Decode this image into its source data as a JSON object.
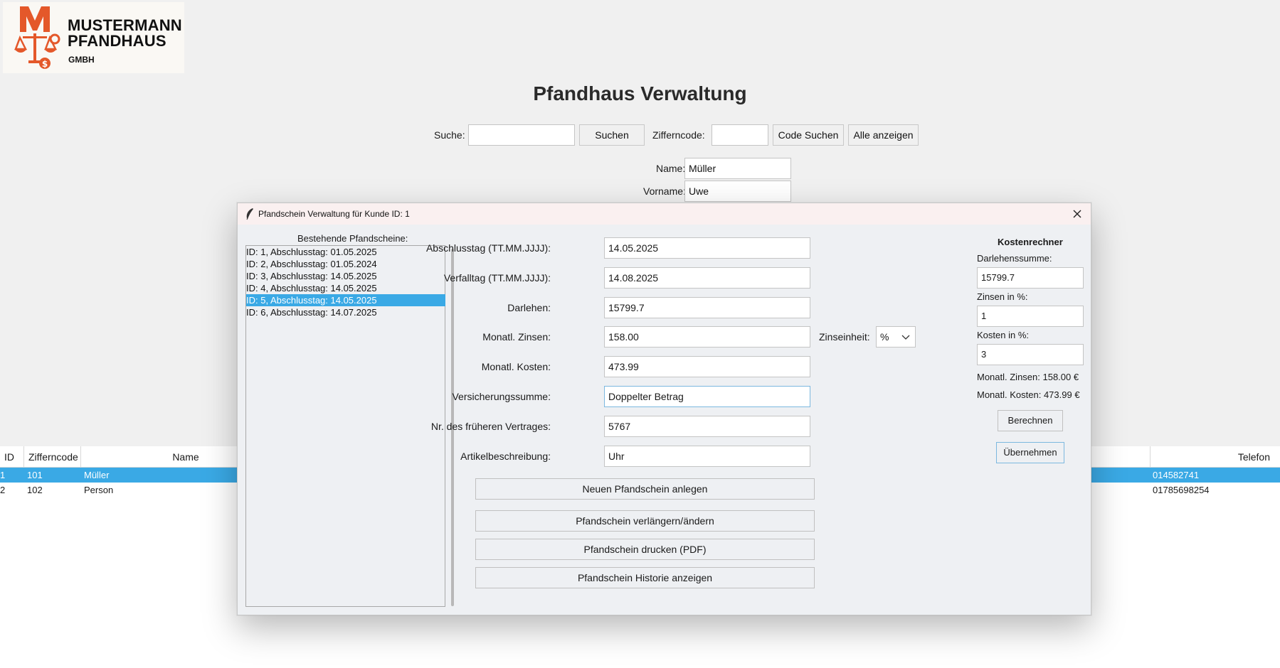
{
  "logo": {
    "line1": "MUSTERMANN",
    "line2": "PFANDHAUS",
    "line3": "GMBH",
    "accent": "#e4582a"
  },
  "app": {
    "title": "Pfandhaus Verwaltung"
  },
  "search": {
    "label": "Suche:",
    "value": "",
    "button": "Suchen",
    "code_label": "Zifferncode:",
    "code_value": "",
    "code_button": "Code Suchen",
    "show_all_button": "Alle anzeigen"
  },
  "customer_form": {
    "name_label": "Name:",
    "name_value": "Müller",
    "vorname_label": "Vorname:",
    "vorname_value": "Uwe"
  },
  "table": {
    "columns": [
      "ID",
      "Zifferncode",
      "Name",
      "Telefon"
    ],
    "rows": [
      {
        "id": "1",
        "code": "101",
        "name": "Müller",
        "telefon": "014582741",
        "selected": true
      },
      {
        "id": "2",
        "code": "102",
        "name": "Person",
        "telefon": "01785698254",
        "selected": false
      }
    ]
  },
  "dialog": {
    "title": "Pfandschein Verwaltung für Kunde ID: 1",
    "list_label": "Bestehende Pfandscheine:",
    "list_items": [
      "ID: 1, Abschlusstag: 01.05.2025",
      "ID: 2, Abschlusstag: 01.05.2024",
      "ID: 3, Abschlusstag: 14.05.2025",
      "ID: 4, Abschlusstag: 14.05.2025",
      "ID: 5, Abschlusstag: 14.05.2025",
      "ID: 6, Abschlusstag: 14.07.2025"
    ],
    "selected_index": 4,
    "fields": {
      "abschlusstag": {
        "label": "Abschlusstag (TT.MM.JJJJ):",
        "value": "14.05.2025"
      },
      "verfalltag": {
        "label": "Verfalltag (TT.MM.JJJJ):",
        "value": "14.08.2025"
      },
      "darlehen": {
        "label": "Darlehen:",
        "value": "15799.7"
      },
      "zinsen": {
        "label": "Monatl. Zinsen:",
        "value": "158.00"
      },
      "kosten": {
        "label": "Monatl. Kosten:",
        "value": "473.99"
      },
      "versicherung": {
        "label": "Versicherungssumme:",
        "value": "Doppelter Betrag"
      },
      "frueherer_vertrag": {
        "label": "Nr. des früheren Vertrages:",
        "value": "5767"
      },
      "artikel": {
        "label": "Artikelbeschreibung:",
        "value": "Uhr"
      }
    },
    "zinseinheit": {
      "label": "Zinseinheit:",
      "value": "%"
    },
    "buttons": {
      "neu": "Neuen Pfandschein anlegen",
      "verlaengern": "Pfandschein verlängern/ändern",
      "drucken": "Pfandschein drucken (PDF)",
      "historie": "Pfandschein Historie anzeigen"
    },
    "calculator": {
      "title": "Kostenrechner",
      "darlehen_label": "Darlehenssumme:",
      "darlehen_value": "15799.7",
      "zinsen_label": "Zinsen in %:",
      "zinsen_value": "1",
      "kosten_label": "Kosten in %:",
      "kosten_value": "3",
      "result_zinsen": "Monatl. Zinsen: 158.00 €",
      "result_kosten": "Monatl. Kosten: 473.99 €",
      "calc_button": "Berechnen",
      "apply_button": "Übernehmen"
    }
  }
}
